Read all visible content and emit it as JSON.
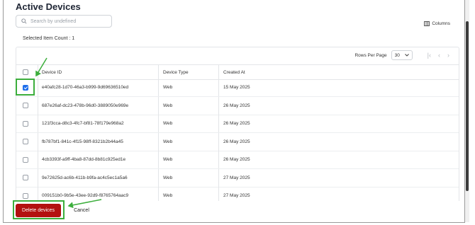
{
  "page": {
    "title": "Active Devices",
    "search_placeholder": "Search by undefined",
    "columns_label": "Columns",
    "selected_count": "Selected Item Count : 1"
  },
  "pagination": {
    "rows_per_page_label": "Rows Per Page",
    "rows_per_page_value": "30"
  },
  "table": {
    "headers": {
      "device_id": "Device ID",
      "device_type": "Device Type",
      "created_at": "Created At"
    },
    "rows": [
      {
        "id": "e40afc28-1d70-46a3-b999-9d69636510ed",
        "type": "Web",
        "created": "15 May 2025",
        "checked": true
      },
      {
        "id": "687e26af-dc23-478b-96d0-3889050e969e",
        "type": "Web",
        "created": "26 May 2025",
        "checked": false
      },
      {
        "id": "121f3cca-d8c3-4fc7-bf81-78f179e968a2",
        "type": "Web",
        "created": "26 May 2025",
        "checked": false
      },
      {
        "id": "fb787bf1-841c-4f15-98ff-8321b2b44a45",
        "type": "Web",
        "created": "26 May 2025",
        "checked": false
      },
      {
        "id": "4cb3393f-a9ff-4ba8-87dd-8b81c925ed1e",
        "type": "Web",
        "created": "26 May 2025",
        "checked": false
      },
      {
        "id": "9e72625d-ac6b-411b-b9fa-ac4c5ec1a5a6",
        "type": "Web",
        "created": "27 May 2025",
        "checked": false
      },
      {
        "id": "009151b0-9b5e-43ee-92d9-f8765764aac9",
        "type": "Web",
        "created": "27 May 2025",
        "checked": false
      }
    ]
  },
  "footer": {
    "delete_label": "Delete devices",
    "cancel_label": "Cancel"
  },
  "colors": {
    "accent_checkbox": "#1f6feb",
    "delete_button": "#b31010",
    "highlight": "#3cae3c"
  },
  "icons": [
    "search-icon",
    "columns-icon",
    "chevron-down-icon",
    "first-page-icon",
    "prev-page-icon",
    "next-page-icon"
  ]
}
